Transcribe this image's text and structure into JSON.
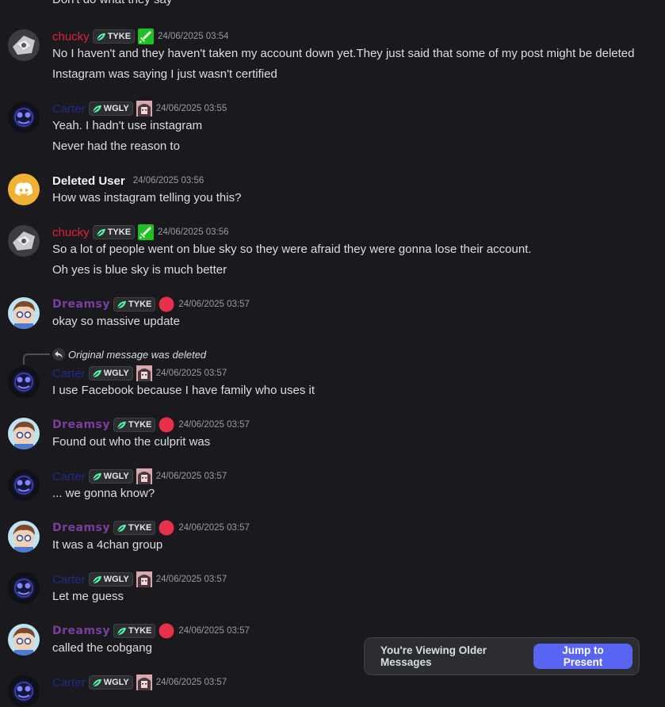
{
  "top_partial_line": "Don't do what they say",
  "tags": {
    "tyke": "TYKE",
    "wgly": "WGLY"
  },
  "reply_preview": "Original message was deleted",
  "messages": [
    {
      "user": "chucky",
      "tag": "TYKE",
      "time": "24/06/2025 03:54",
      "lines": [
        "No I haven't and they haven't taken my account down yet.They just said that some of my post might be deleted",
        "Instagram was saying I just wasn't certified"
      ]
    },
    {
      "user": "Carter",
      "tag": "WGLY",
      "time": "24/06/2025 03:55",
      "lines": [
        "Yeah. I hadn't use instagram",
        "Never had the reason to"
      ]
    },
    {
      "user": "Deleted User",
      "time": "24/06/2025 03:56",
      "lines": [
        "How was instagram telling you this?"
      ]
    },
    {
      "user": "chucky",
      "tag": "TYKE",
      "time": "24/06/2025 03:56",
      "lines": [
        "So a lot of people went on blue sky so they were afraid they were gonna lose their account.",
        "Oh yes is blue sky is much better"
      ]
    },
    {
      "user": "Dreamsy",
      "tag": "TYKE",
      "time": "24/06/2025 03:57",
      "lines": [
        "okay so massive update"
      ]
    },
    {
      "user": "Carter",
      "tag": "WGLY",
      "time": "24/06/2025 03:57",
      "lines": [
        "I use Facebook because I have family who uses it"
      ]
    },
    {
      "user": "Dreamsy",
      "tag": "TYKE",
      "time": "24/06/2025 03:57",
      "lines": [
        "Found out who the culprit was"
      ]
    },
    {
      "user": "Carter",
      "tag": "WGLY",
      "time": "24/06/2025 03:57",
      "lines": [
        "... we gonna know?"
      ]
    },
    {
      "user": "Dreamsy",
      "tag": "TYKE",
      "time": "24/06/2025 03:57",
      "lines": [
        "It was a 4chan group"
      ]
    },
    {
      "user": "Carter",
      "tag": "WGLY",
      "time": "24/06/2025 03:57",
      "lines": [
        "Let me guess"
      ]
    },
    {
      "user": "Dreamsy",
      "tag": "TYKE",
      "time": "24/06/2025 03:57",
      "lines": [
        "called the cobgang"
      ]
    },
    {
      "user": "Carter",
      "tag": "WGLY",
      "time": "24/06/2025 03:57",
      "lines": []
    }
  ],
  "banner": {
    "text": "You're Viewing Older Messages",
    "button": "Jump to Present"
  },
  "colors": {
    "chucky": "#e0203a",
    "carter": "#1f2a8c",
    "dreamsy": "#7a3e9f",
    "accent": "#5865f2",
    "background": "#1a1a1e"
  },
  "icons": {
    "guild_tag": "leaf-icon",
    "chucky_role": "sword-icon",
    "dreamsy_role": "red-dot-icon",
    "carter_role": "anime-avatar-icon",
    "reply": "reply-arrow-icon",
    "deleted_avatar": "discord-logo-icon"
  }
}
